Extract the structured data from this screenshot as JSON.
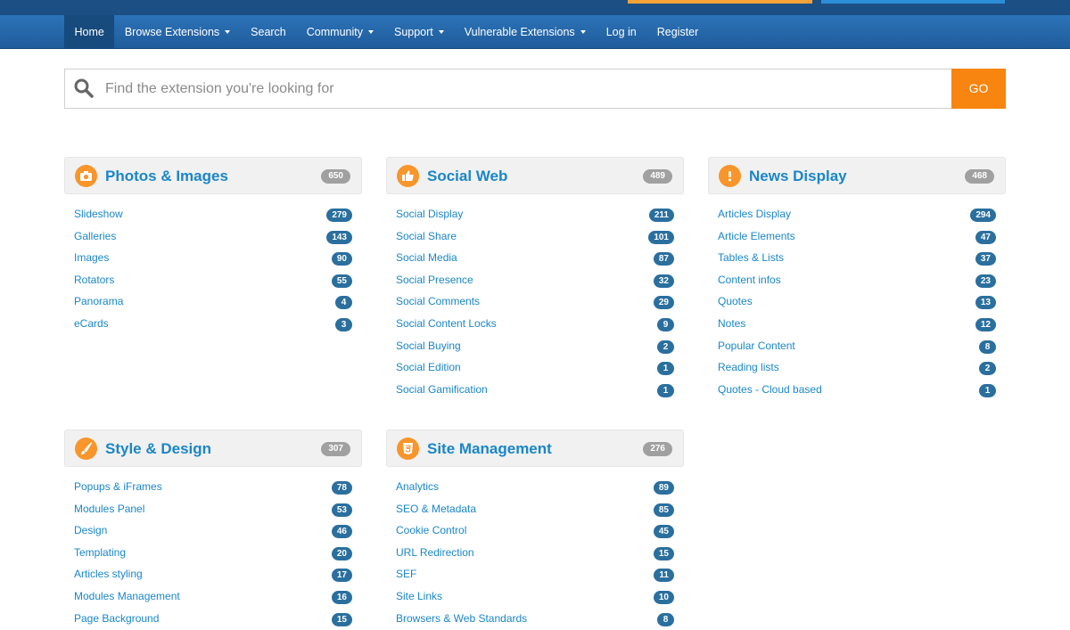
{
  "nav": {
    "home": "Home",
    "browse": "Browse Extensions",
    "search": "Search",
    "community": "Community",
    "support": "Support",
    "vulnerable": "Vulnerable Extensions",
    "login": "Log in",
    "register": "Register"
  },
  "search": {
    "placeholder": "Find the extension you're looking for",
    "go_label": "GO"
  },
  "colors": {
    "accent": "#f7850f",
    "link": "#1a86c7",
    "navbar": "#2566a8",
    "badge": "#2a6f9e"
  },
  "categories": [
    {
      "icon": "camera-icon",
      "title": "Photos & Images",
      "count": "650",
      "items": [
        {
          "label": "Slideshow",
          "count": "279"
        },
        {
          "label": "Galleries",
          "count": "143"
        },
        {
          "label": "Images",
          "count": "90"
        },
        {
          "label": "Rotators",
          "count": "55"
        },
        {
          "label": "Panorama",
          "count": "4"
        },
        {
          "label": "eCards",
          "count": "3"
        }
      ]
    },
    {
      "icon": "thumbs-up-icon",
      "title": "Social Web",
      "count": "489",
      "items": [
        {
          "label": "Social Display",
          "count": "211"
        },
        {
          "label": "Social Share",
          "count": "101"
        },
        {
          "label": "Social Media",
          "count": "87"
        },
        {
          "label": "Social Presence",
          "count": "32"
        },
        {
          "label": "Social Comments",
          "count": "29"
        },
        {
          "label": "Social Content Locks",
          "count": "9"
        },
        {
          "label": "Social Buying",
          "count": "2"
        },
        {
          "label": "Social Edition",
          "count": "1"
        },
        {
          "label": "Social Gamification",
          "count": "1"
        }
      ]
    },
    {
      "icon": "exclamation-icon",
      "title": "News Display",
      "count": "468",
      "items": [
        {
          "label": "Articles Display",
          "count": "294"
        },
        {
          "label": "Article Elements",
          "count": "47"
        },
        {
          "label": "Tables & Lists",
          "count": "37"
        },
        {
          "label": "Content infos",
          "count": "23"
        },
        {
          "label": "Quotes",
          "count": "13"
        },
        {
          "label": "Notes",
          "count": "12"
        },
        {
          "label": "Popular Content",
          "count": "8"
        },
        {
          "label": "Reading lists",
          "count": "2"
        },
        {
          "label": "Quotes - Cloud based",
          "count": "1"
        }
      ]
    },
    {
      "icon": "brush-icon",
      "title": "Style & Design",
      "count": "307",
      "items": [
        {
          "label": "Popups & iFrames",
          "count": "78"
        },
        {
          "label": "Modules Panel",
          "count": "53"
        },
        {
          "label": "Design",
          "count": "46"
        },
        {
          "label": "Templating",
          "count": "20"
        },
        {
          "label": "Articles styling",
          "count": "17"
        },
        {
          "label": "Modules Management",
          "count": "16"
        },
        {
          "label": "Page Background",
          "count": "15"
        }
      ]
    },
    {
      "icon": "html5-icon",
      "title": "Site Management",
      "count": "276",
      "items": [
        {
          "label": "Analytics",
          "count": "89"
        },
        {
          "label": "SEO & Metadata",
          "count": "85"
        },
        {
          "label": "Cookie Control",
          "count": "45"
        },
        {
          "label": "URL Redirection",
          "count": "15"
        },
        {
          "label": "SEF",
          "count": "11"
        },
        {
          "label": "Site Links",
          "count": "10"
        },
        {
          "label": "Browsers & Web Standards",
          "count": "8"
        }
      ]
    }
  ]
}
